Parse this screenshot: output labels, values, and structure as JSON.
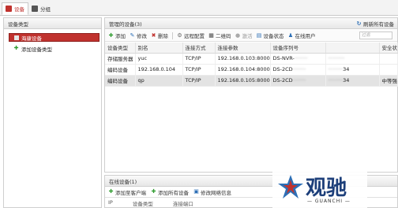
{
  "tabs": [
    {
      "label": "设备",
      "color": "#c0322e"
    },
    {
      "label": "分组",
      "color": "#555555"
    }
  ],
  "left_panel": {
    "title": "设备类型",
    "items": [
      {
        "label": "海康设备",
        "icon": "hik-device-icon",
        "selected": true
      },
      {
        "label": "添加设备类型",
        "icon": "plus-icon",
        "selected": false
      }
    ]
  },
  "managed": {
    "title": "管理的设备(3)",
    "refresh_all": "刷新所有设备",
    "filter_placeholder": "过滤",
    "toolbar": [
      {
        "label": "添加",
        "icon": "plus-icon",
        "color": "#2e9b2e",
        "glyph": "✚"
      },
      {
        "label": "修改",
        "icon": "edit-icon",
        "color": "#2d6fb6",
        "glyph": "✎"
      },
      {
        "label": "删除",
        "icon": "delete-icon",
        "color": "#c0322e",
        "glyph": "✖"
      },
      {
        "label": "远程配置",
        "icon": "gear-icon",
        "color": "#666666",
        "glyph": "⚙"
      },
      {
        "label": "二维码",
        "icon": "qrcode-icon",
        "color": "#444444",
        "glyph": "▦"
      },
      {
        "label": "激活",
        "icon": "activate-icon",
        "color": "#aaaaaa",
        "glyph": "●"
      },
      {
        "label": "设备状态",
        "icon": "status-icon",
        "color": "#2d6fb6",
        "glyph": "▤"
      },
      {
        "label": "在线用户",
        "icon": "user-icon",
        "color": "#2d6fb6",
        "glyph": "♟"
      }
    ],
    "columns": [
      "设备类型",
      "别名",
      "连接方式",
      "连接参数",
      "设备序列号",
      "",
      "安全状"
    ],
    "rows": [
      {
        "type": "存储服务器",
        "alias": "yuc",
        "conn": "TCP/IP",
        "param": "192.168.0.103:8000",
        "serial": "DS-NVR-",
        "serial_tail": "",
        "security": ""
      },
      {
        "type": "编码设备",
        "alias": "192.168.0.104",
        "conn": "TCP/IP",
        "param": "192.168.0.104:8000",
        "serial": "DS-2CD",
        "serial_tail": "34",
        "security": ""
      },
      {
        "type": "编码设备",
        "alias": "qp",
        "conn": "TCP/IP",
        "param": "192.168.0.105:8000",
        "serial": "DS-2CD",
        "serial_tail": "34",
        "security": "中等强"
      }
    ]
  },
  "online": {
    "title": "在线设备(1)",
    "toolbar": [
      {
        "label": "添加至客户端",
        "icon": "plus-icon",
        "color": "#2e9b2e",
        "glyph": "✚"
      },
      {
        "label": "添加所有设备",
        "icon": "plus-icon",
        "color": "#2e9b2e",
        "glyph": "✚"
      },
      {
        "label": "修改网络信息",
        "icon": "network-icon",
        "color": "#2d6fb6",
        "glyph": "▣"
      }
    ],
    "header_partial": [
      "IP",
      "设备类型",
      "连接端口"
    ]
  },
  "watermark": {
    "brand": "观驰",
    "sub": "— GUANCHI —"
  }
}
